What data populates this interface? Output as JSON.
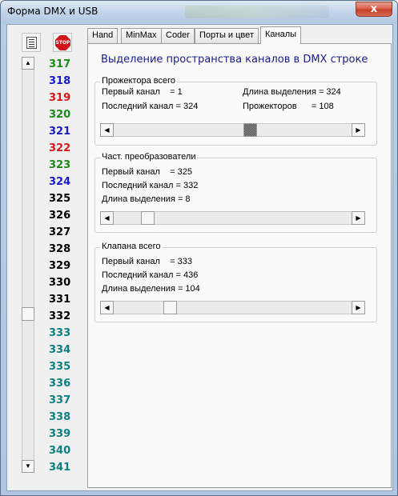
{
  "window": {
    "title": "Форма DMX и USB",
    "close_label": "x"
  },
  "toolbar": {
    "list_icon": "list-icon",
    "stop_icon": "stop-sign-icon",
    "stop_label": "STOP"
  },
  "channel_list": {
    "items": [
      {
        "n": "317",
        "color": "#1a8a1a"
      },
      {
        "n": "318",
        "color": "#1a1acc"
      },
      {
        "n": "319",
        "color": "#d81818"
      },
      {
        "n": "320",
        "color": "#1a8a1a"
      },
      {
        "n": "321",
        "color": "#1a1acc"
      },
      {
        "n": "322",
        "color": "#d81818"
      },
      {
        "n": "323",
        "color": "#1a8a1a"
      },
      {
        "n": "324",
        "color": "#1a1acc"
      },
      {
        "n": "325",
        "color": "#000000"
      },
      {
        "n": "326",
        "color": "#000000"
      },
      {
        "n": "327",
        "color": "#000000"
      },
      {
        "n": "328",
        "color": "#000000"
      },
      {
        "n": "329",
        "color": "#000000"
      },
      {
        "n": "330",
        "color": "#000000"
      },
      {
        "n": "331",
        "color": "#000000"
      },
      {
        "n": "332",
        "color": "#000000"
      },
      {
        "n": "333",
        "color": "#0f8080"
      },
      {
        "n": "334",
        "color": "#0f8080"
      },
      {
        "n": "335",
        "color": "#0f8080"
      },
      {
        "n": "336",
        "color": "#0f8080"
      },
      {
        "n": "337",
        "color": "#0f8080"
      },
      {
        "n": "338",
        "color": "#0f8080"
      },
      {
        "n": "339",
        "color": "#0f8080"
      },
      {
        "n": "340",
        "color": "#0f8080"
      },
      {
        "n": "341",
        "color": "#0f8080"
      }
    ],
    "scroll_position": 0.63
  },
  "tabs": [
    {
      "label": "Hand",
      "active": false
    },
    {
      "label": "MinMax",
      "active": false
    },
    {
      "label": "Coder",
      "active": false
    },
    {
      "label": "Порты и цвет",
      "active": false
    },
    {
      "label": "Каналы",
      "active": true
    }
  ],
  "channels_tab": {
    "heading": "Выделение пространства каналов в DMX строке",
    "projectors": {
      "title": "Прожектора всего",
      "first": "Первый канал    = 1",
      "last": "Последний канал = 324",
      "length": "Длина выделения = 324",
      "count": "Прожекторов      = 108",
      "scroll_position": 0.58
    },
    "converters": {
      "title": "Част. преобразователи",
      "first": "Первый канал    = 325",
      "last": "Последний канал = 332",
      "length": "Длина выделения = 8",
      "scroll_position": 0.12
    },
    "valves": {
      "title": "Клапана всего",
      "first": "Первый канал    = 333",
      "last": "Последний канал = 436",
      "length": "Длина выделения = 104",
      "scroll_position": 0.22
    }
  }
}
